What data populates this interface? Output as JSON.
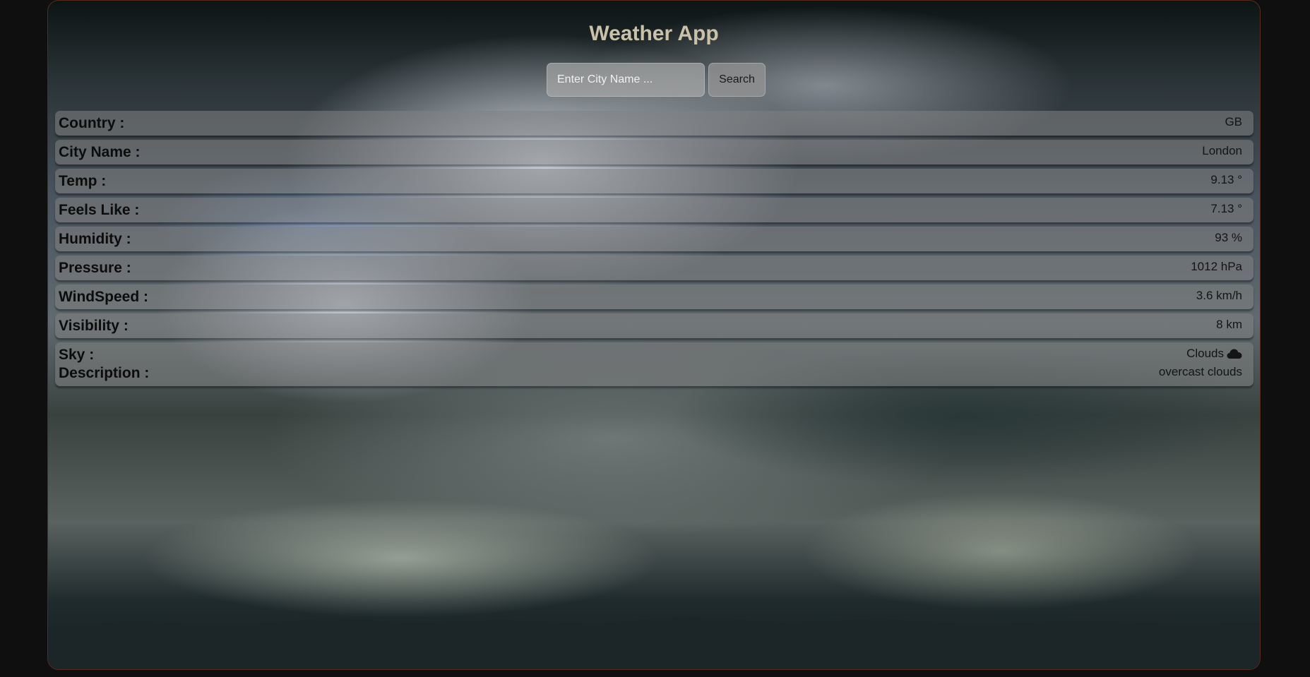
{
  "header": {
    "title": "Weather App"
  },
  "search": {
    "placeholder": "Enter City Name ...",
    "value": "",
    "button_label": "Search"
  },
  "weather": {
    "country": {
      "label": "Country :",
      "value": "GB"
    },
    "city": {
      "label": "City Name :",
      "value": "London"
    },
    "temp": {
      "label": "Temp :",
      "value": "9.13 °"
    },
    "feels_like": {
      "label": "Feels Like :",
      "value": "7.13 °"
    },
    "humidity": {
      "label": "Humidity :",
      "value": "93 %"
    },
    "pressure": {
      "label": "Pressure :",
      "value": "1012 hPa"
    },
    "wind_speed": {
      "label": "WindSpeed :",
      "value": "3.6 km/h"
    },
    "visibility": {
      "label": "Visibility :",
      "value": "8 km"
    },
    "sky": {
      "label": "Sky :",
      "value": "Clouds",
      "icon": "cloud-icon"
    },
    "description": {
      "label": "Description :",
      "value": "overcast clouds"
    }
  }
}
